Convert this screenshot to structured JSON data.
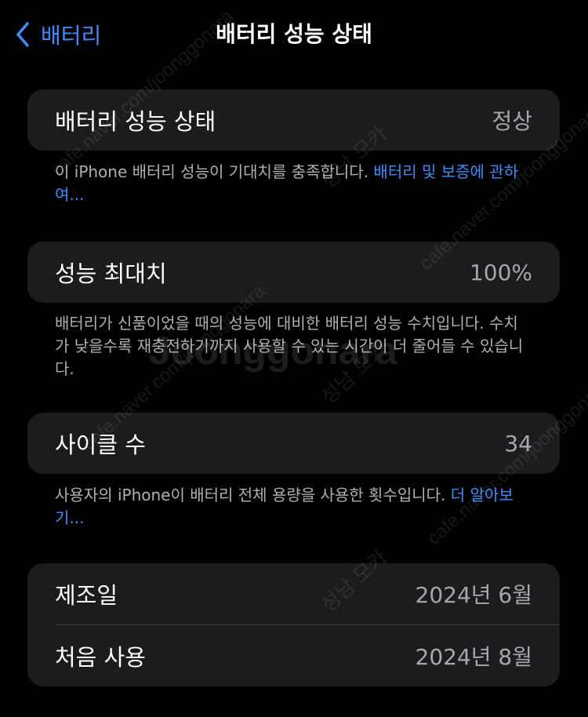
{
  "nav": {
    "back_label": "배터리",
    "title": "배터리 성능 상태"
  },
  "health": {
    "label": "배터리 성능 상태",
    "value": "정상",
    "note_text": "이 iPhone 배터리 성능이 기대치를 충족합니다. ",
    "note_link": "배터리 및 보증에 관하여..."
  },
  "max_capacity": {
    "label": "성능 최대치",
    "value": "100%",
    "note_text": "배터리가 신품이었을 때의 성능에 대비한 배터리 성능 수치입니다. 수치가 낮을수록 재충전하기까지 사용할 수 있는 시간이 더 줄어들 수 있습니다."
  },
  "cycle_count": {
    "label": "사이클 수",
    "value": "34",
    "note_text": "사용자의 iPhone이 배터리 전체 용량을 사용한 횟수입니다. ",
    "note_link": "더 알아보기..."
  },
  "dates": {
    "manufacture_label": "제조일",
    "manufacture_value": "2024년 6월",
    "first_use_label": "처음 사용",
    "first_use_value": "2024년 8월"
  },
  "watermarks": {
    "brand": "Joonggonara",
    "url": "cafe.naver.com/joonggonara",
    "tag": "성남 모카"
  },
  "colors": {
    "background": "#000000",
    "card": "#1c1c1e",
    "accent": "#3a8cff",
    "secondary_text": "#a7a7ab"
  },
  "icons": {
    "back": "chevron-left-icon"
  }
}
